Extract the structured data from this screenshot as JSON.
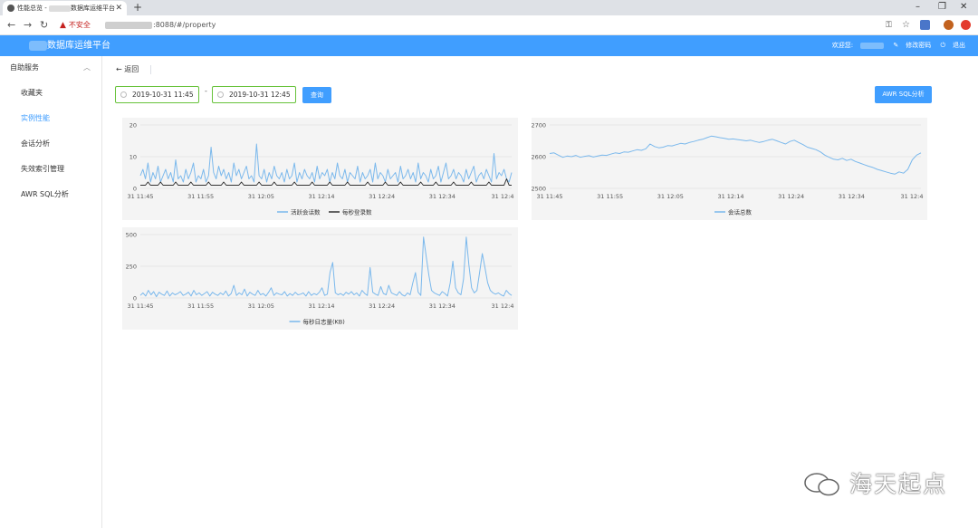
{
  "browser": {
    "tab_title_prefix": "性能总览 - ",
    "tab_title_suffix": "数据库运维平台",
    "security_warning": "不安全",
    "url_suffix": ":8088/#/property"
  },
  "app": {
    "title": "数据库运维平台",
    "welcome": "欢迎您:",
    "change_password": "修改密码",
    "logout": "退出"
  },
  "sidebar": {
    "group_label": "自助服务",
    "items": [
      {
        "label": "收藏夹"
      },
      {
        "label": "实例性能"
      },
      {
        "label": "会话分析"
      },
      {
        "label": "失效索引管理"
      },
      {
        "label": "AWR SQL分析"
      }
    ]
  },
  "main": {
    "back_label": "返回",
    "start_time": "2019-10-31 11:45",
    "separator": "-",
    "end_time": "2019-10-31 12:45",
    "query_button": "查询",
    "awr_button": "AWR SQL分析"
  },
  "colors": {
    "primary": "#409eff",
    "series_blue": "#7ab8ec",
    "series_black": "#333333",
    "date_border": "#67c23a"
  },
  "watermark": "海天起点",
  "chart_data": [
    {
      "type": "line",
      "x_ticks": [
        "31 11:45",
        "31 11:55",
        "31 12:05",
        "31 12:14",
        "31 12:24",
        "31 12:34",
        "31 12:4"
      ],
      "y_ticks": [
        "20",
        "10",
        "0"
      ],
      "ylim": [
        0,
        20
      ],
      "series": [
        {
          "name": "活跃会话数",
          "color": "#7ab8ec",
          "values": [
            4,
            6,
            3,
            8,
            2,
            5,
            3,
            7,
            2,
            4,
            6,
            3,
            5,
            2,
            9,
            3,
            4,
            2,
            6,
            3,
            5,
            8,
            2,
            4,
            3,
            6,
            2,
            4,
            13,
            5,
            3,
            7,
            4,
            6,
            3,
            5,
            2,
            8,
            4,
            6,
            3,
            5,
            7,
            3,
            4,
            2,
            14,
            4,
            3,
            6,
            2,
            5,
            3,
            7,
            4,
            3,
            5,
            2,
            6,
            3,
            4,
            8,
            2,
            5,
            3,
            6,
            4,
            3,
            5,
            2,
            7,
            3,
            5,
            4,
            6,
            2,
            5,
            3,
            8,
            4,
            3,
            6,
            2,
            5,
            4,
            3,
            7,
            2,
            5,
            3,
            4,
            6,
            2,
            8,
            3,
            5,
            4,
            2,
            6,
            3,
            4,
            5,
            2,
            7,
            3,
            4,
            6,
            3,
            5,
            2,
            8,
            3,
            5,
            4,
            2,
            6,
            3,
            4,
            7,
            2,
            5,
            8,
            3,
            4,
            6,
            3,
            5,
            4,
            2,
            6,
            3,
            5,
            7,
            2,
            4,
            5,
            3,
            6,
            4,
            2,
            11,
            3,
            5,
            4,
            6,
            3,
            2,
            5
          ]
        },
        {
          "name": "每秒登录数",
          "color": "#333333",
          "values": [
            1,
            1,
            1,
            2,
            1,
            1,
            1,
            1,
            2,
            1,
            1,
            1,
            1,
            1,
            2,
            1,
            1,
            1,
            1,
            1,
            2,
            1,
            1,
            1,
            1,
            1,
            1,
            2,
            1,
            1,
            1,
            1,
            1,
            2,
            1,
            1,
            1,
            1,
            1,
            1,
            2,
            1,
            1,
            1,
            1,
            1,
            1,
            2,
            1,
            1,
            1,
            1,
            1,
            2,
            1,
            1,
            1,
            1,
            1,
            1,
            1,
            2,
            1,
            1,
            1,
            1,
            1,
            1,
            2,
            1,
            1,
            1,
            1,
            1,
            1,
            2,
            1,
            1,
            1,
            1,
            1,
            1,
            2,
            1,
            1,
            1,
            1,
            1,
            1,
            1,
            2,
            1,
            1,
            1,
            1,
            1,
            1,
            2,
            1,
            1,
            1,
            1,
            1,
            2,
            1,
            1,
            1,
            1,
            1,
            1,
            1,
            2,
            1,
            1,
            1,
            1,
            1,
            2,
            1,
            1,
            1,
            1,
            1,
            1,
            2,
            1,
            1,
            1,
            1,
            1,
            1,
            2,
            1,
            1,
            1,
            1,
            1,
            1,
            2,
            1,
            1,
            1,
            1,
            1,
            1,
            3,
            1,
            1
          ]
        }
      ]
    },
    {
      "type": "line",
      "x_ticks": [
        "31 11:45",
        "31 11:55",
        "31 12:05",
        "31 12:14",
        "31 12:24",
        "31 12:34",
        "31 12:4"
      ],
      "y_ticks": [
        "2700",
        "2600",
        "2500"
      ],
      "ylim": [
        2500,
        2700
      ],
      "series": [
        {
          "name": "会话总数",
          "color": "#7ab8ec",
          "values": [
            2610,
            2612,
            2605,
            2598,
            2602,
            2600,
            2604,
            2598,
            2601,
            2603,
            2599,
            2602,
            2605,
            2604,
            2608,
            2612,
            2610,
            2615,
            2614,
            2618,
            2622,
            2620,
            2625,
            2640,
            2632,
            2628,
            2630,
            2635,
            2634,
            2638,
            2642,
            2640,
            2645,
            2648,
            2652,
            2655,
            2660,
            2665,
            2663,
            2660,
            2658,
            2655,
            2656,
            2654,
            2652,
            2650,
            2652,
            2648,
            2645,
            2648,
            2652,
            2655,
            2650,
            2645,
            2640,
            2648,
            2652,
            2645,
            2638,
            2630,
            2626,
            2622,
            2615,
            2605,
            2598,
            2592,
            2590,
            2595,
            2588,
            2592,
            2585,
            2580,
            2575,
            2570,
            2566,
            2560,
            2556,
            2552,
            2548,
            2545,
            2552,
            2548,
            2560,
            2590,
            2605,
            2612
          ]
        }
      ]
    },
    {
      "type": "line",
      "x_ticks": [
        "31 11:45",
        "31 11:55",
        "31 12:05",
        "31 12:14",
        "31 12:24",
        "31 12:34",
        "31 12:4"
      ],
      "y_ticks": [
        "500",
        "250",
        "0"
      ],
      "ylim": [
        0,
        500
      ],
      "series": [
        {
          "name": "每秒日志量(KB)",
          "color": "#7ab8ec",
          "values": [
            20,
            40,
            15,
            60,
            25,
            50,
            10,
            45,
            30,
            20,
            55,
            15,
            40,
            25,
            35,
            50,
            20,
            30,
            45,
            15,
            60,
            25,
            40,
            20,
            35,
            50,
            15,
            45,
            30,
            20,
            40,
            25,
            55,
            15,
            35,
            100,
            20,
            40,
            25,
            70,
            15,
            45,
            30,
            20,
            60,
            25,
            35,
            15,
            45,
            80,
            20,
            40,
            30,
            25,
            50,
            15,
            35,
            20,
            45,
            25,
            30,
            40,
            15,
            50,
            20,
            35,
            25,
            45,
            80,
            20,
            30,
            200,
            280,
            40,
            25,
            35,
            20,
            45,
            30,
            50,
            25,
            40,
            15,
            60,
            35,
            20,
            240,
            45,
            30,
            20,
            90,
            35,
            25,
            100,
            40,
            30,
            20,
            50,
            25,
            15,
            40,
            25,
            120,
            200,
            45,
            20,
            480,
            330,
            180,
            60,
            40,
            30,
            20,
            50,
            35,
            15,
            120,
            290,
            80,
            40,
            25,
            150,
            480,
            260,
            80,
            40,
            60,
            200,
            350,
            240,
            120,
            60,
            40,
            30,
            40,
            25,
            15,
            60,
            35,
            20
          ]
        }
      ]
    }
  ]
}
